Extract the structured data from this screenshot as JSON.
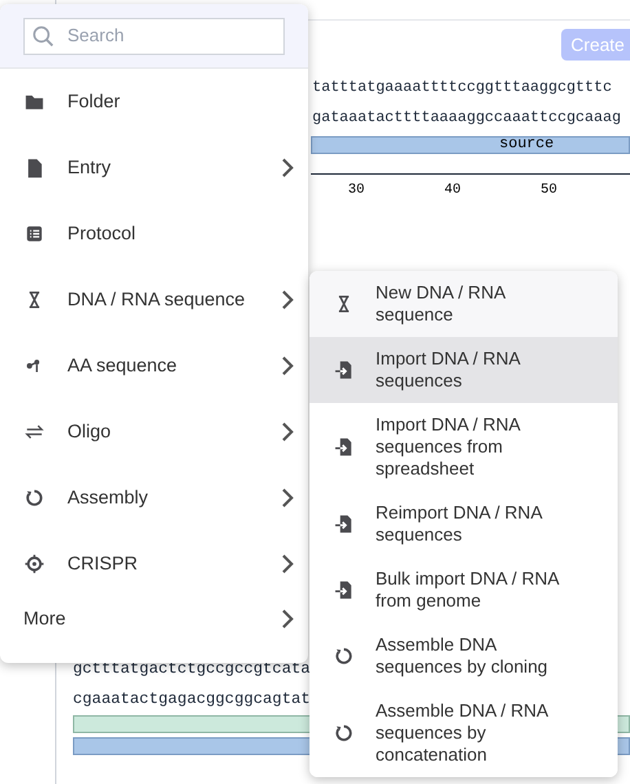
{
  "background": {
    "create_button": "Create",
    "sequence_top": [
      "tatttatgaaaattttccggtttaaggcgtttc",
      "gataaatacttttaaaaggccaaattccgcaaag"
    ],
    "feature_label": "source",
    "ruler_labels": [
      "30",
      "40",
      "50"
    ],
    "sequence_bottom": [
      "gctttatgactctgccgccgtcata",
      "cgaaatactgagacggcggcagtat"
    ]
  },
  "menu": {
    "search": {
      "placeholder": "Search"
    },
    "items": [
      {
        "label": "Folder",
        "has_submenu": false,
        "selected": false
      },
      {
        "label": "Entry",
        "has_submenu": true,
        "selected": false
      },
      {
        "label": "Protocol",
        "has_submenu": false,
        "selected": false
      },
      {
        "label": "DNA / RNA sequence",
        "has_submenu": true,
        "selected": false
      },
      {
        "label": "AA sequence",
        "has_submenu": true,
        "selected": false
      },
      {
        "label": "Oligo",
        "has_submenu": true,
        "selected": false
      },
      {
        "label": "Assembly",
        "has_submenu": true,
        "selected": false
      },
      {
        "label": "CRISPR",
        "has_submenu": true,
        "selected": false
      },
      {
        "label": "More",
        "has_submenu": true,
        "selected": false
      }
    ],
    "submenu": {
      "items": [
        {
          "label": "New DNA / RNA sequence",
          "selected": false
        },
        {
          "label": "Import DNA / RNA sequences",
          "selected": true
        },
        {
          "label": "Import DNA / RNA sequences from spreadsheet",
          "selected": false
        },
        {
          "label": "Reimport DNA / RNA sequences",
          "selected": false
        },
        {
          "label": "Bulk import DNA / RNA from genome",
          "selected": false
        },
        {
          "label": "Assemble DNA sequences by cloning",
          "selected": false
        },
        {
          "label": "Assemble DNA / RNA sequences by concatenation",
          "selected": false
        }
      ]
    }
  }
}
